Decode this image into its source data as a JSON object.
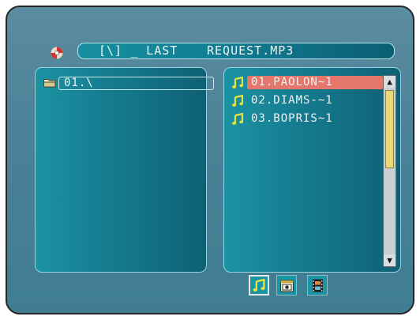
{
  "colors": {
    "screen_bg": "#4b8298",
    "panel_bg": "#167f93",
    "selection": "#e4766b",
    "text": "#f2f2f2",
    "note_icon": "#e6e33a",
    "scroll_thumb": "#e9d972"
  },
  "header": {
    "icon": "disc-icon",
    "path_prefix": "[\\] _ LAST",
    "filename": "REQUEST.MP3"
  },
  "left_panel": {
    "folder": {
      "icon": "folder-icon",
      "label": "01.\\"
    }
  },
  "right_panel": {
    "files": [
      {
        "icon": "music-note-icon",
        "name": "01.PAOLON~1",
        "selected": true
      },
      {
        "icon": "music-note-icon",
        "name": "02.DIAMS-~1",
        "selected": false
      },
      {
        "icon": "music-note-icon",
        "name": "03.BOPRIS~1",
        "selected": false
      }
    ],
    "scrollbar": {
      "up_icon": "scroll-up-arrow-icon",
      "down_icon": "scroll-down-arrow-icon"
    }
  },
  "mode_buttons": [
    {
      "icon": "music-note-icon",
      "active": true
    },
    {
      "icon": "photo-icon",
      "active": false
    },
    {
      "icon": "film-icon",
      "active": false
    }
  ]
}
